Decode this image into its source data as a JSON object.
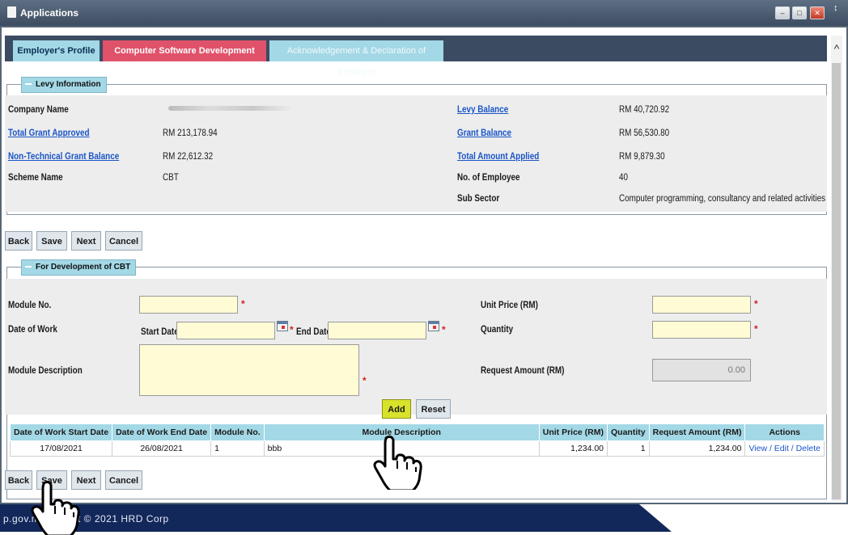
{
  "window": {
    "title": "Applications"
  },
  "tabs": [
    {
      "label": "Employer's Profile"
    },
    {
      "label": "Computer Software Development Details"
    },
    {
      "label": "Acknowledgement & Declaration of Employer"
    }
  ],
  "levy": {
    "legend": "Levy Information",
    "company_name_label": "Company Name",
    "total_grant_approved_label": "Total Grant Approved",
    "total_grant_approved_value": "RM 213,178.94",
    "non_technical_label": "Non-Technical Grant Balance",
    "non_technical_value": "RM 22,612.32",
    "scheme_name_label": "Scheme Name",
    "scheme_name_value": "CBT",
    "levy_balance_label": "Levy Balance",
    "levy_balance_value": "RM 40,720.92",
    "grant_balance_label": "Grant Balance",
    "grant_balance_value": "RM 56,530.80",
    "total_amount_applied_label": "Total Amount Applied",
    "total_amount_applied_value": "RM 9,879.30",
    "employees_label": "No. of Employee",
    "employees_value": "40",
    "sub_sector_label": "Sub Sector",
    "sub_sector_value": "Computer programming, consultancy and related activities"
  },
  "actions": {
    "back": "Back",
    "save": "Save",
    "next": "Next",
    "cancel": "Cancel"
  },
  "form": {
    "legend": "For Development of CBT",
    "module_no_label": "Module No.",
    "date_of_work_label": "Date of Work",
    "start_date_label": "Start Date",
    "end_date_label": "End Date",
    "module_desc_label": "Module Description",
    "unit_price_label": "Unit Price (RM)",
    "quantity_label": "Quantity",
    "request_amount_label": "Request Amount (RM)",
    "request_amount_value": "0.00",
    "required_mark": "*",
    "add": "Add",
    "reset": "Reset"
  },
  "table": {
    "headers": [
      "Date of Work Start Date",
      "Date of Work End Date",
      "Module No.",
      "Module Description",
      "Unit Price (RM)",
      "Quantity",
      "Request Amount (RM)",
      "Actions"
    ],
    "rows": [
      {
        "start": "17/08/2021",
        "end": "26/08/2021",
        "module": "1",
        "desc": "bbb",
        "unit_price": "1,234.00",
        "qty": "1",
        "amount": "1,234.00",
        "actions": "View / Edit / Delete"
      }
    ]
  },
  "footer": {
    "text": "p.gov.m    opyright © 2021 HRD Corp"
  }
}
